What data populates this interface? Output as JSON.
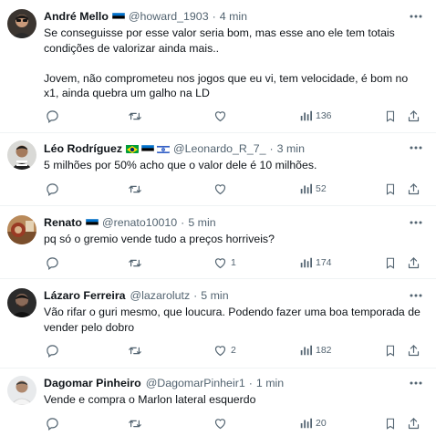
{
  "colors": {
    "text": "#0f1419",
    "muted": "#536471",
    "divider": "#eff3f4"
  },
  "icons": {
    "more": "more-icon",
    "reply": "reply-icon",
    "retweet": "retweet-icon",
    "like": "like-icon",
    "views": "views-icon",
    "bookmark": "bookmark-icon",
    "share": "share-icon"
  },
  "separator": "·",
  "tweets": [
    {
      "name": "André Mello",
      "flags": [
        "estonia"
      ],
      "handle": "@howard_1903",
      "time": "4 min",
      "text": "Se conseguisse por esse valor seria bom, mas esse ano ele tem totais condições de valorizar ainda mais..\n\nJovem, não comprometeu nos jogos que eu vi, tem velocidade, é bom no x1, ainda quebra um galho na LD",
      "likes": "",
      "views": "136"
    },
    {
      "name": "Léo Rodríguez",
      "flags": [
        "brazil",
        "estonia",
        "israel"
      ],
      "handle": "@Leonardo_R_7_",
      "time": "3 min",
      "text": "5 milhões por 50% acho que o valor dele é 10 milhões.",
      "likes": "",
      "views": "52"
    },
    {
      "name": "Renato",
      "flags": [
        "estonia"
      ],
      "handle": "@renato10010",
      "time": "5 min",
      "text": "pq só o gremio vende tudo a preços horriveis?",
      "likes": "1",
      "views": "174"
    },
    {
      "name": "Lázaro Ferreira",
      "flags": [],
      "handle": "@lazarolutz",
      "time": "5 min",
      "text": "Vão rifar o guri mesmo, que loucura. Podendo fazer uma boa temporada de vender pelo dobro",
      "likes": "2",
      "views": "182"
    },
    {
      "name": "Dagomar Pinheiro",
      "flags": [],
      "handle": "@DagomarPinheir1",
      "time": "1 min",
      "text": "Vende e compra o Marlon lateral esquerdo",
      "likes": "",
      "views": "20"
    }
  ]
}
